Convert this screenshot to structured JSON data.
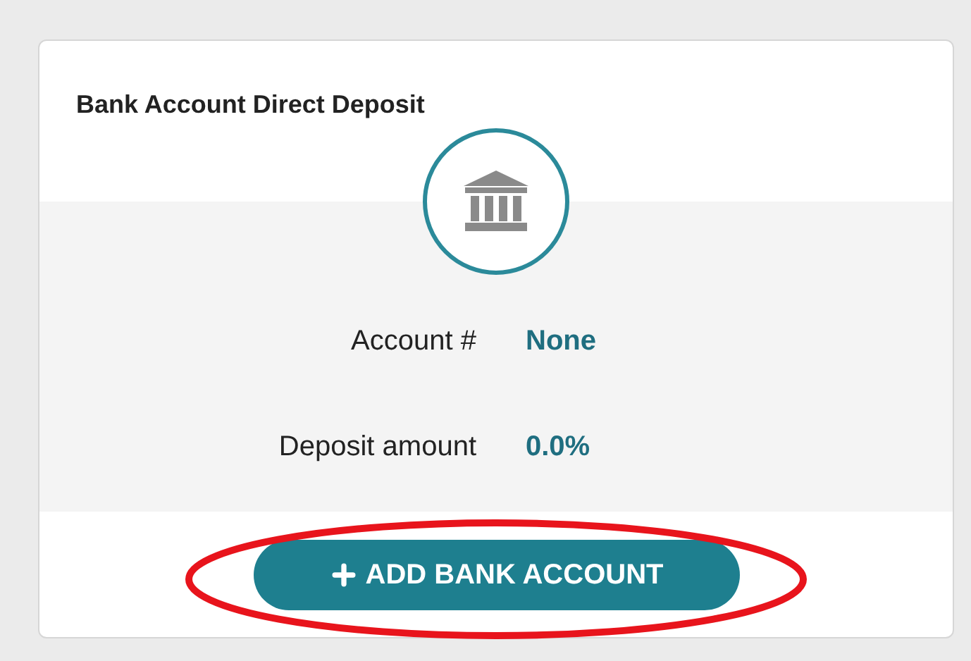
{
  "card": {
    "title": "Bank Account Direct Deposit"
  },
  "fields": [
    {
      "label": "Account #",
      "value": "None"
    },
    {
      "label": "Deposit amount",
      "value": "0.0%"
    }
  ],
  "button": {
    "label": "ADD BANK ACCOUNT"
  }
}
